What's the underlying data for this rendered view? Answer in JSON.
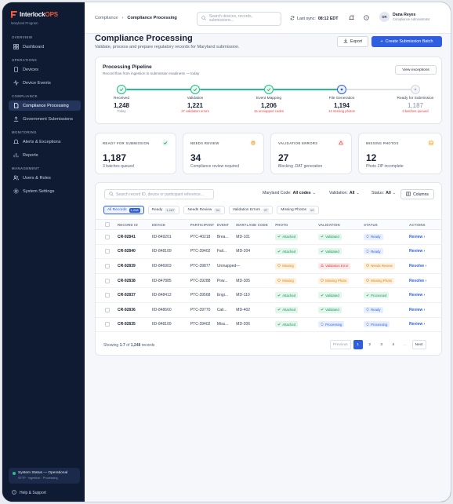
{
  "brand": {
    "name_prefix": "Interlock",
    "name_suffix": "OPS",
    "program": "Maryland Program"
  },
  "sidebar": {
    "sections": [
      "OVERVIEW",
      "OPERATIONS",
      "COMPLIANCE",
      "MONITORING",
      "MANAGEMENT"
    ],
    "items": [
      {
        "label": "Dashboard",
        "icon": "grid-icon"
      },
      {
        "label": "Devices",
        "icon": "device-icon"
      },
      {
        "label": "Device Events",
        "icon": "pulse-icon"
      },
      {
        "label": "Compliance Processing",
        "icon": "document-icon",
        "active": true
      },
      {
        "label": "Government Submissions",
        "icon": "upload-icon"
      },
      {
        "label": "Alerts & Exceptions",
        "icon": "bell-icon"
      },
      {
        "label": "Reports",
        "icon": "report-icon"
      },
      {
        "label": "Users & Roles",
        "icon": "users-icon"
      },
      {
        "label": "System Settings",
        "icon": "gear-icon"
      }
    ],
    "system_status": "System Status — Operational",
    "system_sub": "SFTP · Ingestion · Processing",
    "help": "Help & Support"
  },
  "topbar": {
    "breadcrumb_parent": "Compliance",
    "breadcrumb_current": "Compliance Processing",
    "search_placeholder_1": "Search devices, records,",
    "search_placeholder_2": "submissions...",
    "sync_label": "Last sync:",
    "sync_time": "08:12 EDT",
    "user_initials": "DR",
    "user_name": "Dana Reyes",
    "user_role": "Compliance Administrator"
  },
  "page": {
    "title": "Compliance Processing",
    "subtitle": "Validate, process and prepare regulatory records for Maryland submission.",
    "export_label": "Export",
    "create_label": "Create Submission Batch"
  },
  "pipeline": {
    "title": "Processing Pipeline",
    "subtitle": "Record flow from ingestion to submission readiness — today",
    "exceptions_label": "View exceptions",
    "stages": [
      {
        "label": "Received",
        "value": "1,248",
        "note": "Today",
        "note_type": "muted",
        "state": "done"
      },
      {
        "label": "Validation",
        "value": "1,221",
        "note": "27 validation errors",
        "note_type": "err",
        "state": "done"
      },
      {
        "label": "Event Mapping",
        "value": "1,206",
        "note": "15 unmapped codes",
        "note_type": "err",
        "state": "done"
      },
      {
        "label": "File Generation",
        "value": "1,194",
        "note": "12 missing photos",
        "note_type": "err",
        "state": "active"
      },
      {
        "label": "Ready for Submission",
        "value": "1,187",
        "note": "3 batches queued",
        "note_type": "err",
        "state": "pending"
      }
    ]
  },
  "stats": [
    {
      "label": "READY FOR SUBMISSION",
      "value": "1,187",
      "sub": "3 batches queued",
      "icon": "check-icon",
      "color": "#1c9a62"
    },
    {
      "label": "NEEDS REVIEW",
      "value": "34",
      "sub": "Compliance review required",
      "icon": "clock-icon",
      "color": "#d9821a"
    },
    {
      "label": "VALIDATION ERRORS",
      "value": "27",
      "sub": "Blocking .DAT generation",
      "icon": "warning-icon",
      "color": "#d94141"
    },
    {
      "label": "MISSING PHOTOS",
      "value": "12",
      "sub": "Photo ZIP incomplete",
      "icon": "image-icon",
      "color": "#d9a21a"
    }
  ],
  "table": {
    "search_placeholder": "Search record ID, device or participant reference...",
    "filters": [
      {
        "label": "Maryland Code:",
        "value": "All codes"
      },
      {
        "label": "Validation:",
        "value": "All"
      },
      {
        "label": "Status:",
        "value": "All"
      }
    ],
    "columns_label": "Columns",
    "tabs": [
      {
        "label": "All Records",
        "count": "1,248",
        "active": true
      },
      {
        "label": "Ready",
        "count": "1,187"
      },
      {
        "label": "Needs Review",
        "count": "34"
      },
      {
        "label": "Validation Errors",
        "count": "27"
      },
      {
        "label": "Missing Photos",
        "count": "12"
      }
    ],
    "headers": [
      "RECORD ID",
      "DEVICE",
      "PARTICIPANT",
      "EVENT",
      "MARYLAND CODE",
      "PHOTO",
      "VALIDATION",
      "STATUS",
      "ACTIONS"
    ],
    "rows": [
      {
        "id": "CR-92841",
        "device": "IID-849201",
        "participant": "PTC-40218",
        "event": "Brea...",
        "code": "MD-101",
        "photo": [
          "Attached",
          "green"
        ],
        "validation": [
          "Validated",
          "green"
        ],
        "status": [
          "Ready",
          "blue"
        ],
        "action": "Review"
      },
      {
        "id": "CR-92840",
        "device": "IID-848109",
        "participant": "PTC-39402",
        "event": "Fail...",
        "code": "MD-204",
        "photo": [
          "Attached",
          "green"
        ],
        "validation": [
          "Validated",
          "green"
        ],
        "status": [
          "Ready",
          "blue"
        ],
        "action": "Review"
      },
      {
        "id": "CR-92839",
        "device": "IID-846903",
        "participant": "PTC-39877",
        "event": "Unmapped",
        "code": "—",
        "photo": [
          "Missing",
          "orange"
        ],
        "validation": [
          "Validation Error",
          "red"
        ],
        "status": [
          "Needs Review",
          "orange"
        ],
        "action": "Resolve"
      },
      {
        "id": "CR-92838",
        "device": "IID-847885",
        "participant": "PTC-39288",
        "event": "Pow...",
        "code": "MD-305",
        "photo": [
          "Missing",
          "orange"
        ],
        "validation": [
          "Missing Photo",
          "orange"
        ],
        "status": [
          "Missing Photo",
          "orange"
        ],
        "action": "Resolve"
      },
      {
        "id": "CR-92837",
        "device": "IID-848412",
        "participant": "PTC-39568",
        "event": "Engi...",
        "code": "MD-110",
        "photo": [
          "Attached",
          "green"
        ],
        "validation": [
          "Validated",
          "green"
        ],
        "status": [
          "Processed",
          "green"
        ],
        "action": "Review"
      },
      {
        "id": "CR-92836",
        "device": "IID-848660",
        "participant": "PTC-39770",
        "event": "Cali...",
        "code": "MD-402",
        "photo": [
          "Attached",
          "green"
        ],
        "validation": [
          "Validated",
          "green"
        ],
        "status": [
          "Ready",
          "blue"
        ],
        "action": "Review"
      },
      {
        "id": "CR-92835",
        "device": "IID-848109",
        "participant": "PTC-39402",
        "event": "Miss...",
        "code": "MD-206",
        "photo": [
          "Attached",
          "green"
        ],
        "validation": [
          "Processing",
          "blue"
        ],
        "status": [
          "Processing",
          "blue"
        ],
        "action": "Review"
      }
    ],
    "footer_prefix": "Showing",
    "footer_range": "1-7",
    "footer_of": "of",
    "footer_total": "1,248",
    "footer_suffix": "records",
    "pagination": {
      "prev": "Previous",
      "pages": [
        "1",
        "2",
        "3",
        "4"
      ],
      "ellipsis": "...",
      "next": "Next",
      "current": "1"
    }
  }
}
